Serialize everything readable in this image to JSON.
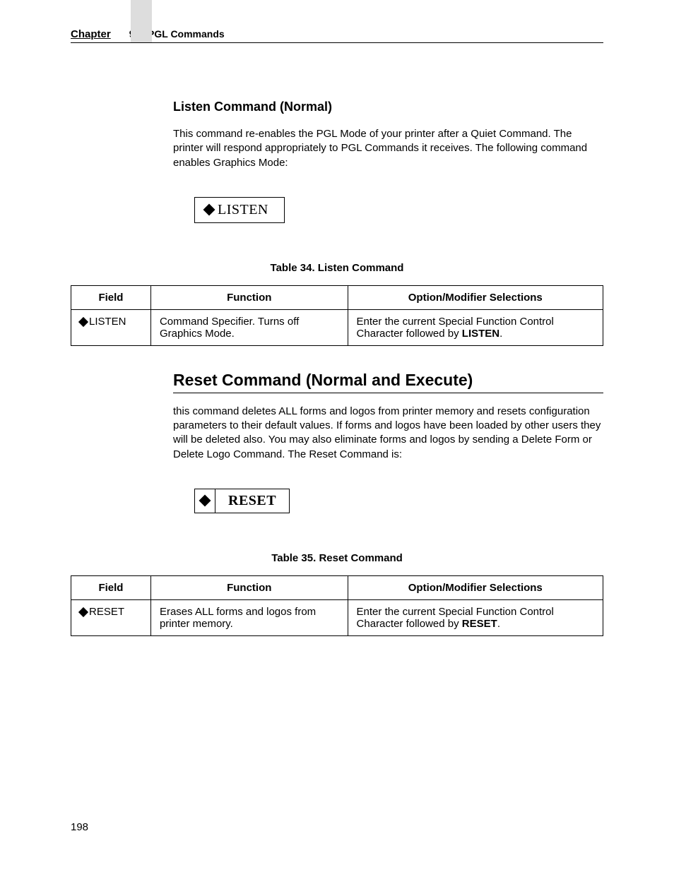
{
  "header": {
    "chapter_label": "Chapter",
    "chapter_number": "9",
    "section_title": "PGL Commands"
  },
  "section1": {
    "heading": "Listen Command (Normal)",
    "paragraph": "This command re-enables the PGL Mode of your printer after a Quiet Command. The printer will respond appropriately to PGL Commands it receives. The following command enables Graphics Mode:",
    "code_text": "LISTEN",
    "table_caption": "Table 34. Listen Command",
    "table": {
      "headers": [
        "Field",
        "Function",
        "Option/Modifier Selections"
      ],
      "row": {
        "field": "LISTEN",
        "function": "Command Specifier. Turns off Graphics Mode.",
        "option_prefix": "Enter the current Special Function Control Character followed by ",
        "option_bold": "LISTEN",
        "option_suffix": "."
      }
    }
  },
  "section2": {
    "heading": "Reset Command (Normal and Execute)",
    "paragraph": "this command deletes ALL forms and logos from printer memory and resets configuration parameters to their default values. If forms and logos have been loaded by other users they will be deleted also. You may also eliminate forms and logos by sending a Delete Form or Delete Logo Command. The Reset Command is:",
    "code_text": "RESET",
    "table_caption": "Table 35. Reset Command",
    "table": {
      "headers": [
        "Field",
        "Function",
        "Option/Modifier Selections"
      ],
      "row": {
        "field": "RESET",
        "function": "Erases ALL forms and logos from printer memory.",
        "option_prefix": "Enter the current Special Function Control Character followed by ",
        "option_bold": "RESET",
        "option_suffix": "."
      }
    }
  },
  "page_number": "198"
}
